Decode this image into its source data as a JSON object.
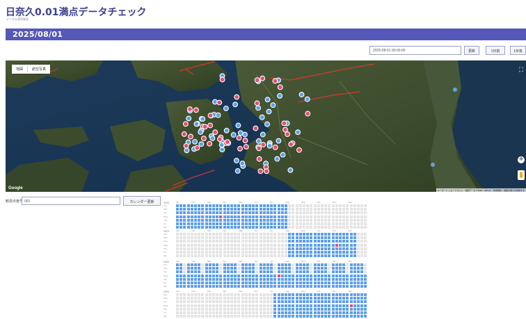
{
  "header": {
    "title": "日奈久0.01満点データチェック",
    "subtitle": "データ欠測率確認"
  },
  "date_bar": {
    "date": "2025/08/01"
  },
  "controls": {
    "datetime_value": "2025-08-01 00:00:00",
    "update_label": "更新",
    "back_label": "1日前",
    "forward_label": "1日後"
  },
  "map": {
    "type_map": "地図",
    "type_satellite": "航空写真",
    "logo": "Google",
    "attribution": "キーボード ショートカット　地図データ ©2025　200 km　利用規約　地図の誤りを報告する",
    "stations_ok": 60,
    "stations_bad": 45
  },
  "station": {
    "label": "観測点番号",
    "value": "001",
    "calendar_button": "カレンダー更新"
  },
  "calendar": {
    "dow": [
      "Sun",
      "Mon",
      "Tue",
      "Wed",
      "Thu",
      "Fri",
      "Sat"
    ],
    "months": [
      "Jan",
      "Feb",
      "Mar",
      "Apr",
      "May",
      "Jun",
      "Jul",
      "Aug",
      "Sep",
      "Oct",
      "Nov",
      "Dec"
    ],
    "years": [
      {
        "year": "2025",
        "status": "ok-from-start-to-aug",
        "bad_weeks": [
          12
        ]
      },
      {
        "year": "2024",
        "status": "ok-from-aug",
        "bad_weeks": [
          44
        ]
      },
      {
        "year": "2023",
        "status": "ok-full-year",
        "bad_weeks": [
          28
        ]
      },
      {
        "year": "2022",
        "status": "ok-from-jul",
        "bad_weeks": [
          48
        ]
      }
    ]
  },
  "colors": {
    "accent": "#5558b8",
    "ok": "#5d9fe8",
    "bad": "#e05070",
    "none": "#e3e3e3"
  }
}
